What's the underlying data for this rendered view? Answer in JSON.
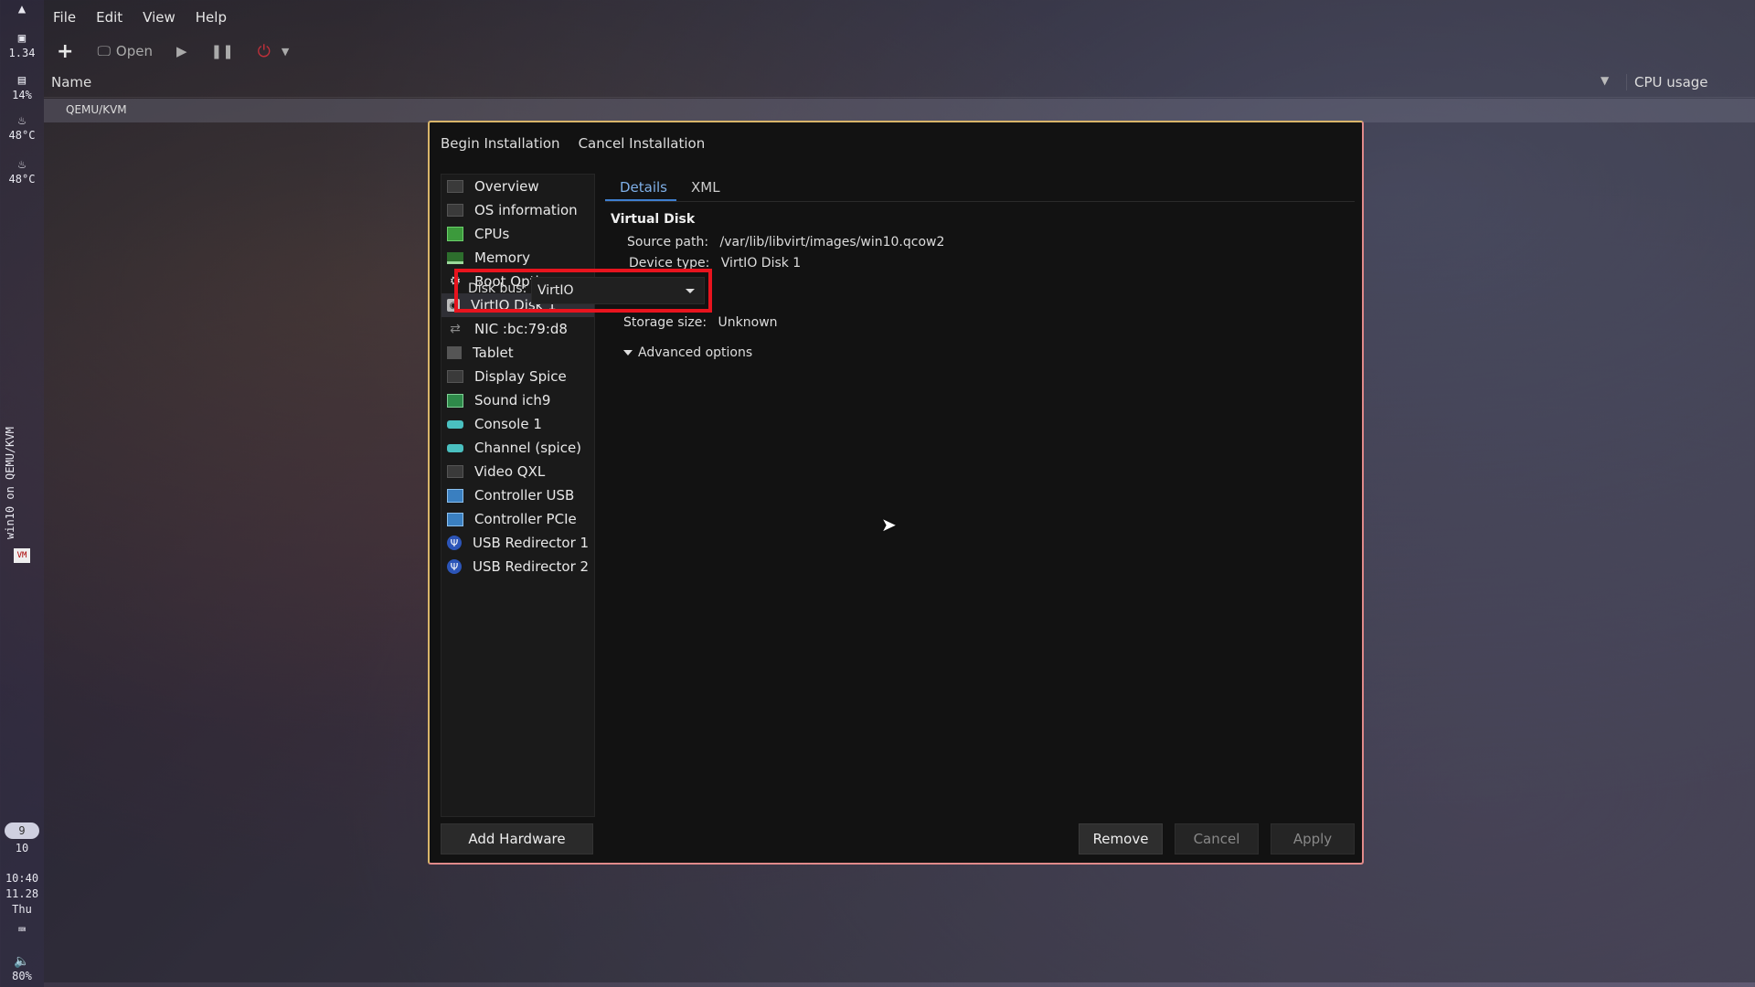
{
  "leftbar": {
    "cpu_load": "1.34",
    "mem_usage": "14%",
    "temp1": "48°C",
    "temp2": "48°C",
    "window_title": "win10 on QEMU/KVM",
    "workspace_current": "9",
    "workspace_total": "10",
    "time": "10:40",
    "date": "11.28",
    "weekday": "Thu",
    "volume": "80%"
  },
  "menubar": {
    "items": [
      "File",
      "Edit",
      "View",
      "Help"
    ]
  },
  "toolbar": {
    "open_label": "Open"
  },
  "list_header": {
    "name": "Name",
    "cpu_usage": "CPU usage"
  },
  "connection": {
    "label": "QEMU/KVM"
  },
  "dialog": {
    "begin_label": "Begin Installation",
    "cancel_install_label": "Cancel Installation",
    "hardware": [
      {
        "label": "Overview",
        "icon": "screen-icon"
      },
      {
        "label": "OS information",
        "icon": "screen-icon"
      },
      {
        "label": "CPUs",
        "icon": "cpu-icon"
      },
      {
        "label": "Memory",
        "icon": "memory-icon"
      },
      {
        "label": "Boot Options",
        "icon": "gear-icon"
      },
      {
        "label": "VirtIO Disk 1",
        "icon": "disk-icon"
      },
      {
        "label": "NIC :bc:79:d8",
        "icon": "nic-icon"
      },
      {
        "label": "Tablet",
        "icon": "tablet-icon"
      },
      {
        "label": "Display Spice",
        "icon": "screen-icon"
      },
      {
        "label": "Sound ich9",
        "icon": "sound-card-icon"
      },
      {
        "label": "Console 1",
        "icon": "serial-icon"
      },
      {
        "label": "Channel (spice)",
        "icon": "serial-icon"
      },
      {
        "label": "Video QXL",
        "icon": "screen-icon"
      },
      {
        "label": "Controller USB",
        "icon": "controller-icon"
      },
      {
        "label": "Controller PCIe",
        "icon": "controller-icon"
      },
      {
        "label": "USB Redirector 1",
        "icon": "usb-icon"
      },
      {
        "label": "USB Redirector 2",
        "icon": "usb-icon"
      }
    ],
    "selected_index": 5,
    "add_hardware_label": "Add Hardware",
    "tabs": [
      "Details",
      "XML"
    ],
    "active_tab": "Details",
    "details": {
      "section_title": "Virtual Disk",
      "source_path_label": "Source path:",
      "source_path_value": "/var/lib/libvirt/images/win10.qcow2",
      "device_type_label": "Device type:",
      "device_type_value": "VirtIO Disk 1",
      "disk_bus_label": "Disk bus:",
      "disk_bus_value": "VirtIO",
      "storage_size_label": "Storage size:",
      "storage_size_value": "Unknown",
      "advanced_label": "Advanced options"
    },
    "remove_label": "Remove",
    "cancel_label": "Cancel",
    "apply_label": "Apply"
  },
  "colors": {
    "highlight": "#e8141e",
    "accent": "#3f7fd0",
    "dialog_border": "#d9b56a"
  }
}
